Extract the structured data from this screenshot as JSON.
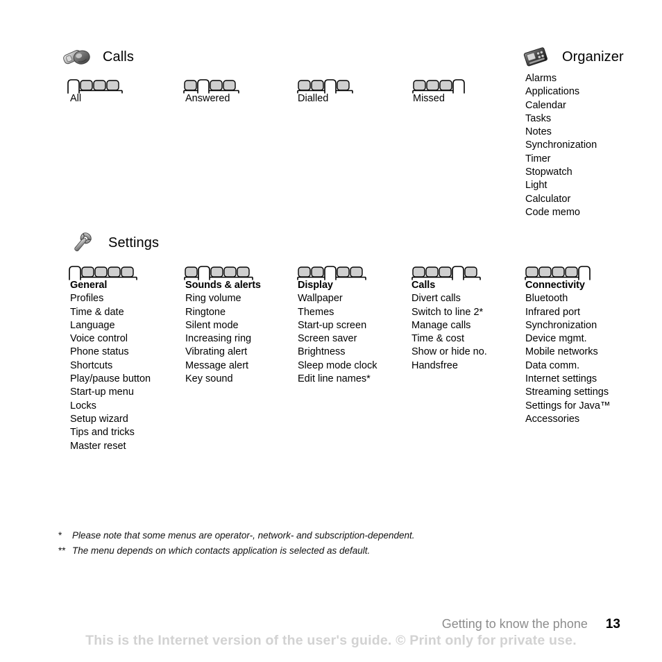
{
  "document": {
    "page_number": "13",
    "running_header": "Getting to know the phone",
    "watermark_notice": "This is the Internet version of the user's guide. © Print only for private use."
  },
  "sections": {
    "calls": {
      "icon": "calls-phone-icon",
      "title": "Calls",
      "tabs": [
        {
          "label": "All",
          "count": 4,
          "selected": 1
        },
        {
          "label": "Answered",
          "count": 4,
          "selected": 2
        },
        {
          "label": "Dialled",
          "count": 4,
          "selected": 3
        },
        {
          "label": "Missed",
          "count": 4,
          "selected": 4
        }
      ]
    },
    "organizer": {
      "icon": "organizer-icon",
      "title": "Organizer",
      "items": [
        "Alarms",
        "Applications",
        "Calendar",
        "Tasks",
        "Notes",
        "Synchronization",
        "Timer",
        "Stopwatch",
        "Light",
        "Calculator",
        "Code memo"
      ]
    },
    "settings": {
      "icon": "wrench-icon",
      "title": "Settings",
      "columns": [
        {
          "head": "General",
          "tabs": {
            "count": 5,
            "selected": 1
          },
          "items": [
            "Profiles",
            "Time & date",
            "Language",
            "Voice control",
            "Phone status",
            "Shortcuts",
            "Play/pause button",
            "Start-up menu",
            "Locks",
            "Setup wizard",
            "Tips and tricks",
            "Master reset"
          ]
        },
        {
          "head": "Sounds & alerts",
          "tabs": {
            "count": 5,
            "selected": 2
          },
          "items": [
            "Ring volume",
            "Ringtone",
            "Silent mode",
            "Increasing ring",
            "Vibrating alert",
            "Message alert",
            "Key sound"
          ]
        },
        {
          "head": "Display",
          "tabs": {
            "count": 5,
            "selected": 3
          },
          "items": [
            "Wallpaper",
            "Themes",
            "Start-up screen",
            "Screen saver",
            "Brightness",
            "Sleep mode clock",
            "Edit line names*"
          ]
        },
        {
          "head": "Calls",
          "tabs": {
            "count": 5,
            "selected": 4
          },
          "items": [
            "Divert calls",
            "Switch to line 2*",
            "Manage calls",
            "Time & cost",
            "Show or hide no.",
            "Handsfree"
          ]
        },
        {
          "head": "Connectivity",
          "tabs": {
            "count": 5,
            "selected": 5
          },
          "items": [
            "Bluetooth",
            "Infrared port",
            "Synchronization",
            "Device mgmt.",
            "Mobile networks",
            "Data comm.",
            "Internet settings",
            "Streaming settings",
            "Settings for Java™",
            "Accessories"
          ]
        }
      ]
    }
  },
  "footnotes": [
    {
      "mark": "*",
      "text": "Please note that some menus are operator-, network- and subscription-dependent."
    },
    {
      "mark": "**",
      "text": "The menu depends on which contacts application is selected as default."
    }
  ],
  "colors": {
    "tab_fill": "#cfcfcf",
    "tab_stroke": "#000000",
    "watermark": "#d2d2d2",
    "running_header": "#8c8c8c"
  }
}
